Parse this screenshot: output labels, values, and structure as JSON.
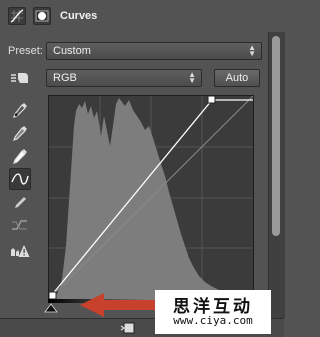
{
  "panel": {
    "title": "Curves",
    "header_icons": [
      "curves-adjustment-icon",
      "layer-mask-icon"
    ]
  },
  "preset": {
    "label": "Preset:",
    "value": "Custom"
  },
  "channel": {
    "value": "RGB"
  },
  "auto_button": {
    "label": "Auto"
  },
  "tools": [
    "on-image-adjust-icon",
    "black-point-eyedropper-icon",
    "gray-point-eyedropper-icon",
    "white-point-eyedropper-icon",
    "edit-curve-points-icon",
    "draw-curve-pencil-icon",
    "smooth-curve-icon",
    "clipping-warning-icon"
  ],
  "watermark": {
    "chinese": "思洋互动",
    "url": "www.ciya.com"
  },
  "colors": {
    "panel_bg": "#535353",
    "graph_bg": "#3b3b3b",
    "histogram": "#7d7d7d",
    "curve": "#ffffff",
    "arrow": "#c8412c"
  }
}
